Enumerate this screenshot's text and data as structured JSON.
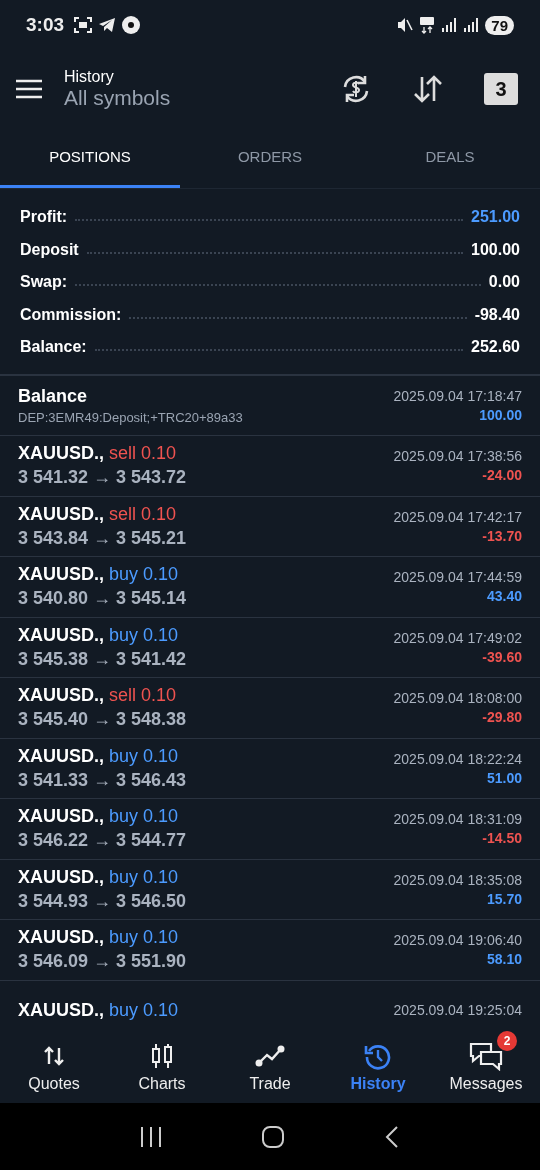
{
  "status_bar": {
    "time": "3:03",
    "battery": "79"
  },
  "header": {
    "title": "History",
    "subtitle": "All symbols",
    "calendar_day": "3"
  },
  "tabs": [
    {
      "label": "POSITIONS",
      "selected": true
    },
    {
      "label": "ORDERS",
      "selected": false
    },
    {
      "label": "DEALS",
      "selected": false
    }
  ],
  "summary": [
    {
      "label": "Profit:",
      "value": "251.00",
      "highlight": true
    },
    {
      "label": "Deposit",
      "value": "100.00",
      "highlight": false
    },
    {
      "label": "Swap:",
      "value": "0.00",
      "highlight": false
    },
    {
      "label": "Commission:",
      "value": "-98.40",
      "highlight": false
    },
    {
      "label": "Balance:",
      "value": "252.60",
      "highlight": false
    }
  ],
  "rows": [
    {
      "kind": "balance",
      "title": "Balance",
      "comment": "DEP:3EMR49:Deposit;+TRC20+89a33",
      "time": "2025.09.04 17:18:47",
      "profit": {
        "text": "100.00",
        "kind": "gain"
      }
    },
    {
      "kind": "trade",
      "symbol": "XAUUSD.,",
      "action": {
        "text": "sell 0.10",
        "kind": "sell"
      },
      "prices": "3 541.32 → 3 543.72",
      "time": "2025.09.04 17:38:56",
      "profit": {
        "text": "-24.00",
        "kind": "loss"
      }
    },
    {
      "kind": "trade",
      "symbol": "XAUUSD.,",
      "action": {
        "text": "sell 0.10",
        "kind": "sell"
      },
      "prices": "3 543.84 → 3 545.21",
      "time": "2025.09.04 17:42:17",
      "profit": {
        "text": "-13.70",
        "kind": "loss"
      }
    },
    {
      "kind": "trade",
      "symbol": "XAUUSD.,",
      "action": {
        "text": "buy 0.10",
        "kind": "buy"
      },
      "prices": "3 540.80 → 3 545.14",
      "time": "2025.09.04 17:44:59",
      "profit": {
        "text": "43.40",
        "kind": "gain"
      }
    },
    {
      "kind": "trade",
      "symbol": "XAUUSD.,",
      "action": {
        "text": "buy 0.10",
        "kind": "buy"
      },
      "prices": "3 545.38 → 3 541.42",
      "time": "2025.09.04 17:49:02",
      "profit": {
        "text": "-39.60",
        "kind": "loss"
      }
    },
    {
      "kind": "trade",
      "symbol": "XAUUSD.,",
      "action": {
        "text": "sell 0.10",
        "kind": "sell"
      },
      "prices": "3 545.40 → 3 548.38",
      "time": "2025.09.04 18:08:00",
      "profit": {
        "text": "-29.80",
        "kind": "loss"
      }
    },
    {
      "kind": "trade",
      "symbol": "XAUUSD.,",
      "action": {
        "text": "buy 0.10",
        "kind": "buy"
      },
      "prices": "3 541.33 → 3 546.43",
      "time": "2025.09.04 18:22:24",
      "profit": {
        "text": "51.00",
        "kind": "gain"
      }
    },
    {
      "kind": "trade",
      "symbol": "XAUUSD.,",
      "action": {
        "text": "buy 0.10",
        "kind": "buy"
      },
      "prices": "3 546.22 → 3 544.77",
      "time": "2025.09.04 18:31:09",
      "profit": {
        "text": "-14.50",
        "kind": "loss"
      }
    },
    {
      "kind": "trade",
      "symbol": "XAUUSD.,",
      "action": {
        "text": "buy 0.10",
        "kind": "buy"
      },
      "prices": "3 544.93 → 3 546.50",
      "time": "2025.09.04 18:35:08",
      "profit": {
        "text": "15.70",
        "kind": "gain"
      }
    },
    {
      "kind": "trade",
      "symbol": "XAUUSD.,",
      "action": {
        "text": "buy 0.10",
        "kind": "buy"
      },
      "prices": "3 546.09 → 3 551.90",
      "time": "2025.09.04 19:06:40",
      "profit": {
        "text": "58.10",
        "kind": "gain"
      }
    },
    {
      "kind": "trade",
      "symbol": "XAUUSD.,",
      "action": {
        "text": "buy 0.10",
        "kind": "buy"
      },
      "time": "2025.09.04 19:25:04"
    }
  ],
  "bottom_nav": [
    {
      "kind": "quotes",
      "label": "Quotes",
      "selected": false
    },
    {
      "kind": "charts",
      "label": "Charts",
      "selected": false
    },
    {
      "kind": "trade",
      "label": "Trade",
      "selected": false
    },
    {
      "kind": "history",
      "label": "History",
      "selected": true
    },
    {
      "kind": "messages",
      "label": "Messages",
      "selected": false,
      "badge": "2"
    }
  ]
}
